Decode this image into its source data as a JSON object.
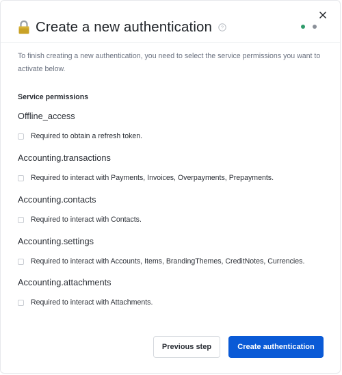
{
  "modal": {
    "title": "Create a new authentication",
    "intro": "To finish creating a new authentication, you need to select the service permissions you want to activate below.",
    "section_label": "Service permissions",
    "step_colors": {
      "active": "#2e9b6a",
      "inactive": "#8a8f98"
    },
    "accent": "#0a5ad6"
  },
  "permissions": [
    {
      "name": "Offline_access",
      "description": "Required to obtain a refresh token.",
      "checked": false
    },
    {
      "name": "Accounting.transactions",
      "description": "Required to interact with Payments, Invoices, Overpayments, Prepayments.",
      "checked": false
    },
    {
      "name": "Accounting.contacts",
      "description": "Required to interact with Contacts.",
      "checked": false
    },
    {
      "name": "Accounting.settings",
      "description": "Required to interact with Accounts, Items, BrandingThemes, CreditNotes, Currencies.",
      "checked": false
    },
    {
      "name": "Accounting.attachments",
      "description": "Required to interact with Attachments.",
      "checked": false
    }
  ],
  "footer": {
    "previous_label": "Previous step",
    "create_label": "Create authentication"
  },
  "icons": {
    "close": "close-icon",
    "lock": "lock-icon",
    "help": "help-icon"
  }
}
